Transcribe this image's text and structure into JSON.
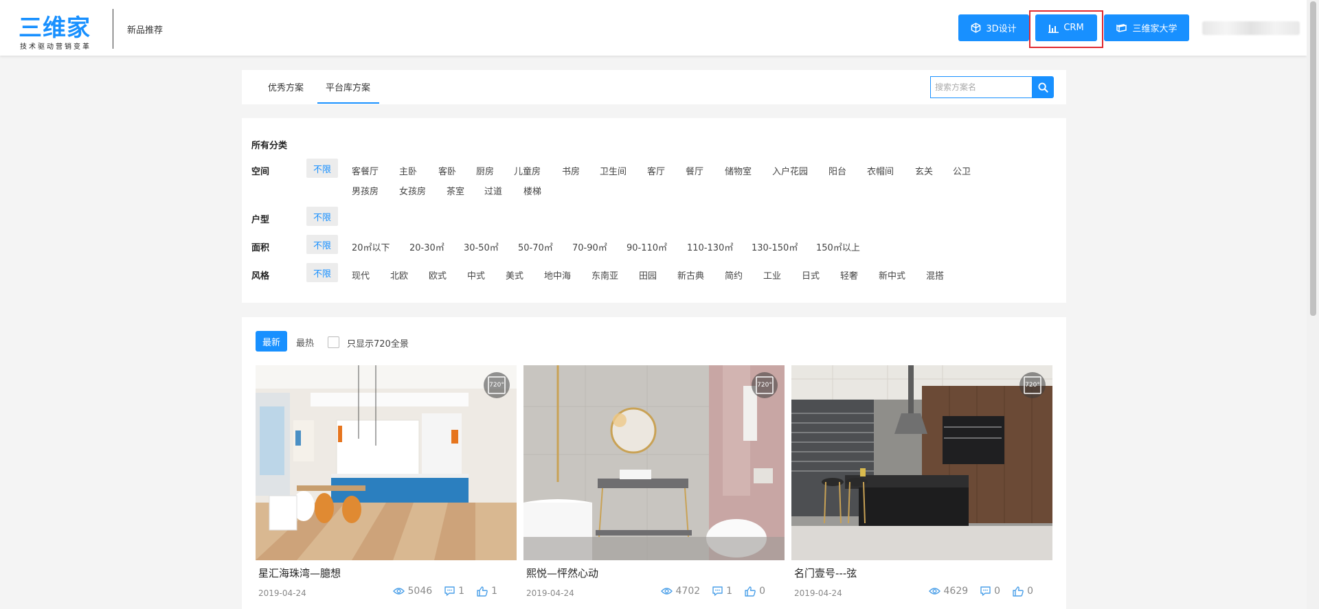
{
  "header": {
    "logo_main": "三维家",
    "logo_sub": "技术驱动营销变革",
    "nav_new_products": "新品推荐",
    "buttons": {
      "design_3d": "3D设计",
      "crm": "CRM",
      "university": "三维家大学"
    }
  },
  "tabs": {
    "excellent": "优秀方案",
    "platform": "平台库方案",
    "search_placeholder": "搜索方案名"
  },
  "filters": {
    "all_categories": "所有分类",
    "rows": [
      {
        "label": "空间",
        "active": "不限",
        "options": [
          "客餐厅",
          "主卧",
          "客卧",
          "厨房",
          "儿童房",
          "书房",
          "卫生间",
          "客厅",
          "餐厅",
          "储物室",
          "入户花园",
          "阳台",
          "衣帽间",
          "玄关",
          "公卫",
          "男孩房",
          "女孩房",
          "茶室",
          "过道",
          "楼梯"
        ]
      },
      {
        "label": "户型",
        "active": "不限",
        "options": []
      },
      {
        "label": "面积",
        "active": "不限",
        "options": [
          "20㎡以下",
          "20-30㎡",
          "30-50㎡",
          "50-70㎡",
          "70-90㎡",
          "90-110㎡",
          "110-130㎡",
          "130-150㎡",
          "150㎡以上"
        ]
      },
      {
        "label": "风格",
        "active": "不限",
        "options": [
          "现代",
          "北欧",
          "欧式",
          "中式",
          "美式",
          "地中海",
          "东南亚",
          "田园",
          "新古典",
          "简约",
          "工业",
          "日式",
          "轻奢",
          "新中式",
          "混搭"
        ]
      }
    ]
  },
  "sort": {
    "newest": "最新",
    "hottest": "最热",
    "pano_only": "只显示720全景"
  },
  "badge_text": "720°",
  "cards": [
    {
      "title": "星汇海珠湾—臆想",
      "date": "2019-04-24",
      "views": "5046",
      "comments": "1",
      "likes": "1"
    },
    {
      "title": "熙悦—怦然心动",
      "date": "2019-04-24",
      "views": "4702",
      "comments": "1",
      "likes": "0"
    },
    {
      "title": "名门壹号---弦",
      "date": "2019-04-24",
      "views": "4629",
      "comments": "0",
      "likes": "0"
    }
  ],
  "colors": {
    "accent": "#1890ff",
    "highlight_box": "#e0282f"
  }
}
